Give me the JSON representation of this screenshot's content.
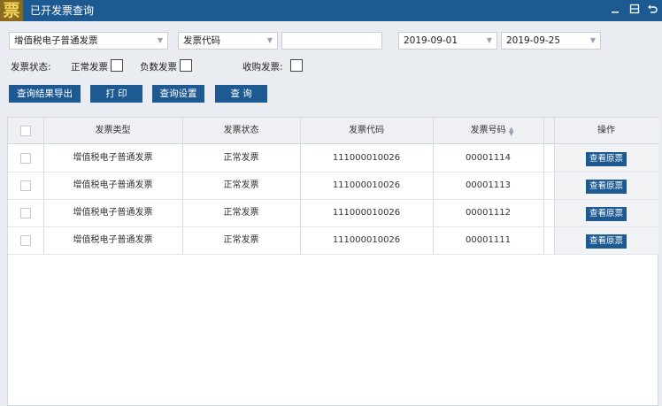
{
  "window": {
    "icon_glyph": "票",
    "title": "已开发票查询",
    "controls": [
      "minimize-icon",
      "restore-icon",
      "back-icon"
    ]
  },
  "filters": {
    "invoice_type": "增值税电子普通发票",
    "search_field": "发票代码",
    "search_value": "",
    "date_from": "2019-09-01",
    "date_to": "2019-09-25",
    "status_label": "发票状态:",
    "normal_label": "正常发票",
    "negative_label": "负数发票",
    "purchase_label": "收购发票:",
    "normal_checked": false,
    "negative_checked": false,
    "purchase_checked": false
  },
  "toolbar": {
    "export_label": "查询结果导出",
    "print_label": "打 印",
    "settings_label": "查询设置",
    "query_label": "查 询"
  },
  "table": {
    "columns": [
      "发票类型",
      "发票状态",
      "发票代码",
      "发票号码",
      "操作"
    ],
    "rows": [
      {
        "type": "增值税电子普通发票",
        "status": "正常发票",
        "code": "111000010026",
        "number": "00001114",
        "action": "查看原票"
      },
      {
        "type": "增值税电子普通发票",
        "status": "正常发票",
        "code": "111000010026",
        "number": "00001113",
        "action": "查看原票"
      },
      {
        "type": "增值税电子普通发票",
        "status": "正常发票",
        "code": "111000010026",
        "number": "00001112",
        "action": "查看原票"
      },
      {
        "type": "增值税电子普通发票",
        "status": "正常发票",
        "code": "111000010026",
        "number": "00001111",
        "action": "查看原票"
      }
    ]
  },
  "colors": {
    "titlebar": "#1d5a92",
    "button": "#1d5a92",
    "background": "#e9edf2"
  }
}
